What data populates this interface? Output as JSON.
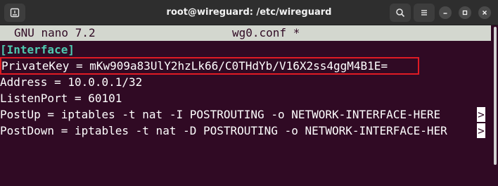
{
  "window": {
    "title": "root@wireguard: /etc/wireguard"
  },
  "titlebar": {
    "icons": [
      "new-tab-icon",
      "search-icon",
      "hamburger-menu-icon",
      "minimize-icon",
      "maximize-icon",
      "close-icon"
    ]
  },
  "nano": {
    "app": "GNU nano 7.2",
    "file": "wg0.conf *"
  },
  "content": {
    "section": "[Interface]",
    "private_key": "PrivateKey = mKw909a83UlY2hzLk66/C0THdYb/V16X2ss4ggM4B1E=",
    "address": "Address = 10.0.0.1/32",
    "listen_port": "ListenPort = 60101",
    "post_up": "PostUp = iptables -t nat -I POSTROUTING -o NETWORK-INTERFACE-HERE ",
    "post_down": "PostDown = iptables -t nat -D POSTROUTING -o NETWORK-INTERFACE-HER",
    "overflow_marker": ">"
  },
  "colors": {
    "terminal_bg": "#300a24",
    "section_header": "#4ec9b0",
    "highlight_box": "#e01b24"
  }
}
